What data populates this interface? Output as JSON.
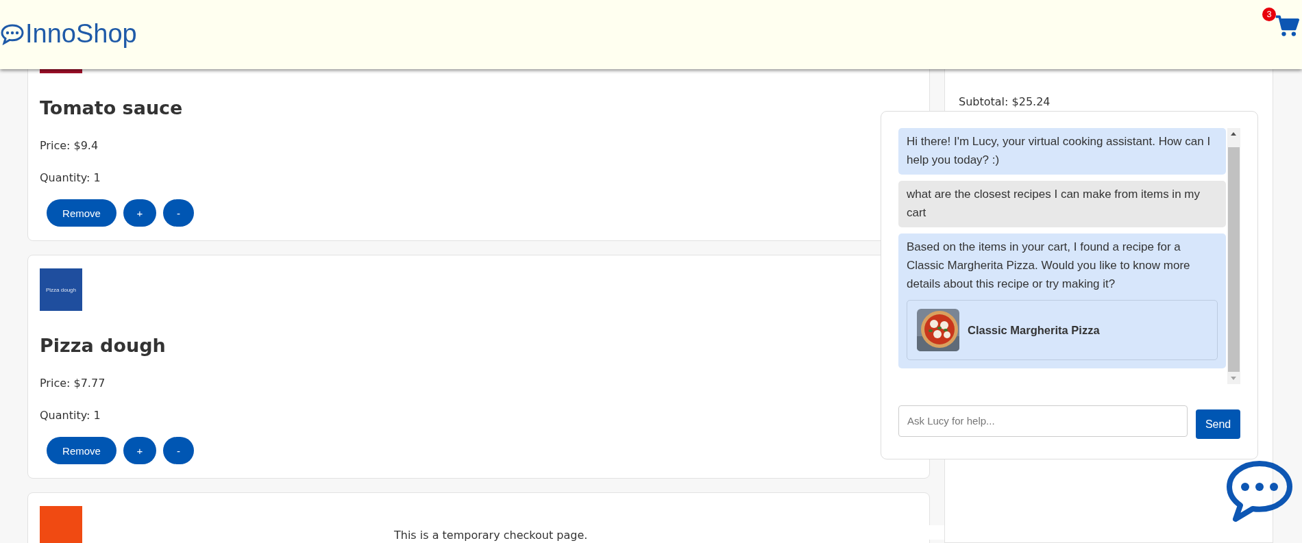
{
  "header": {
    "logo": "InnoShop",
    "cart_count": "3"
  },
  "cart_items": [
    {
      "image": {
        "color": "#a3102a"
      },
      "name": "Tomato sauce",
      "price": "Price: $9.4",
      "quantity": "Quantity: 1",
      "buttons": [
        "Remove",
        "+",
        "-"
      ]
    },
    {
      "image": {
        "color": "#1f4e9e",
        "label": "Pizza dough"
      },
      "name": "Pizza dough",
      "price": "Price: $7.77",
      "quantity": "Quantity: 1",
      "buttons": [
        "Remove",
        "+",
        "-"
      ]
    },
    {
      "image": {
        "color": "#f04a12"
      }
    }
  ],
  "summary": {
    "subtotal": "Subtotal: $25.24"
  },
  "chat": {
    "messages": [
      {
        "kind": "bot",
        "text": "Hi there! I'm Lucy, your virtual cooking assistant. How can I help you today? :)"
      },
      {
        "kind": "user",
        "text": "what are the closest recipes I can make from items in my cart"
      },
      {
        "kind": "bot",
        "text": "Based on the items in your cart, I found a recipe for a Classic Margherita Pizza. Would you like to know more details about this recipe or try making it?",
        "recipe": {
          "title": "Classic Margherita Pizza"
        }
      }
    ],
    "input": {
      "placeholder": "Ask Lucy for help..."
    },
    "send": "Send"
  },
  "footer_note": "This is a temporary checkout page."
}
